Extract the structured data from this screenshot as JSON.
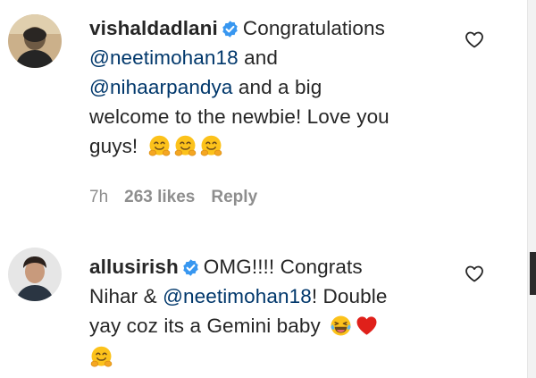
{
  "comments": [
    {
      "username": "vishaldadlani",
      "lines": [
        [
          "Congratulations"
        ],
        [
          "@neetimohan18",
          " and"
        ],
        [
          "@nihaarpandya",
          " and a big"
        ],
        [
          "welcome to the newbie! Love you"
        ],
        [
          "guys!"
        ]
      ],
      "time": "7h",
      "likes": "263 likes",
      "reply": "Reply"
    },
    {
      "username": "allusirish",
      "lines": [
        [
          "OMG!!!! Congrats"
        ],
        [
          "Nihar & ",
          "@neetimohan18",
          "! Double"
        ],
        [
          "yay coz its a Gemini baby"
        ]
      ]
    }
  ],
  "icons": {
    "verified": "verified-badge-icon",
    "like": "heart-outline-icon",
    "hug": "hugging-face-emoji",
    "laugh": "tears-of-joy-emoji",
    "red_heart": "red-heart-emoji"
  },
  "colors": {
    "text": "#262626",
    "mention": "#00376b",
    "meta": "#8e8e8e",
    "verified": "#3897f0",
    "emoji": "#fcc21b",
    "heart": "#e0201a"
  }
}
